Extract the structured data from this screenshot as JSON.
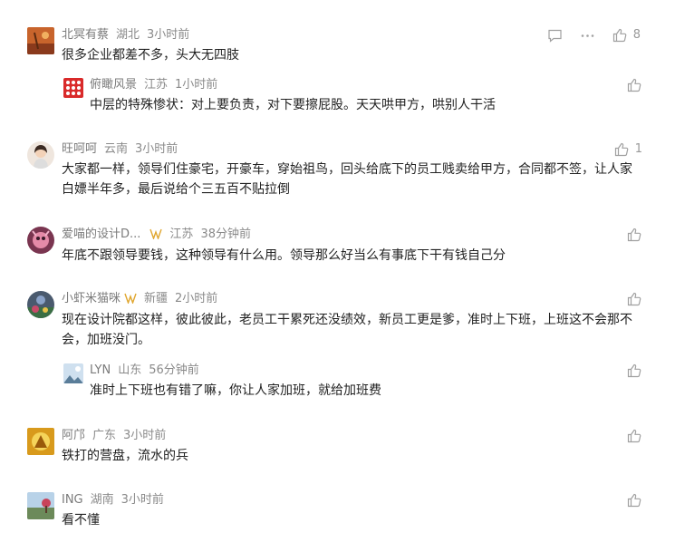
{
  "comments": [
    {
      "name": "北冥有蔡",
      "region": "湖北",
      "time": "3小时前",
      "text": "很多企业都差不多，头大无四肢",
      "likes": "8",
      "reply": {
        "name": "俯瞰风景",
        "region": "江苏",
        "time": "1小时前",
        "text": "中层的特殊惨状：对上要负责，对下要擦屁股。天天哄甲方，哄别人干活"
      }
    },
    {
      "name": "旺呵呵",
      "region": "云南",
      "time": "3小时前",
      "text": "大家都一样，领导们住豪宅，开豪车，穿始祖鸟，回头给底下的员工贱卖给甲方，合同都不签，让人家白嫖半年多，最后说给个三五百不贴拉倒",
      "likes": "1"
    },
    {
      "name": "爱喵的设计D...",
      "region": "江苏",
      "time": "38分钟前",
      "text": "年底不跟领导要钱，这种领导有什么用。领导那么好当么有事底下干有钱自己分"
    },
    {
      "name": "小虾米猫咪",
      "region": "新疆",
      "time": "2小时前",
      "text": "现在设计院都这样，彼此彼此，老员工干累死还没绩效，新员工更是爹，准时上下班，上班这不会那不会，加班没门。",
      "reply": {
        "name": "LYN",
        "region": "山东",
        "time": "56分钟前",
        "text": "准时上下班也有错了嘛，你让人家加班，就给加班费"
      }
    },
    {
      "name": "阿邝",
      "region": "广东",
      "time": "3小时前",
      "text": "铁打的营盘，流水的兵"
    },
    {
      "name": "ING",
      "region": "湖南",
      "time": "3小时前",
      "text": "看不懂"
    }
  ]
}
